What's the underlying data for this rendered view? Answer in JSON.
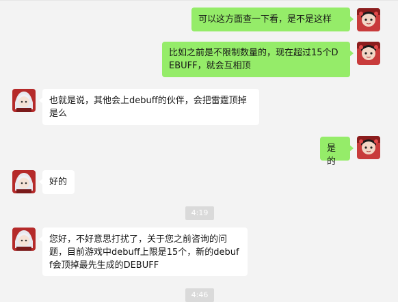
{
  "messages": [
    {
      "side": "out",
      "text": "可以这方面查一下看，是不是这样"
    },
    {
      "side": "out",
      "text": "比如之前是不限制数量的，现在超过15个DEBUFF，就会互相顶"
    },
    {
      "side": "in",
      "text": "也就是说，其他会上debuff的伙伴，会把雷霆顶掉是么"
    },
    {
      "side": "out",
      "text": "是的"
    },
    {
      "side": "in",
      "text": "好的"
    },
    {
      "side": "in",
      "text": "您好，不好意思打扰了，关于您之前咨询的问题，目前游戏中debuff上限是15个，新的debuff会顶掉最先生成的DEBUFF"
    }
  ],
  "timestamps": [
    "4:19",
    "4:46"
  ],
  "colors": {
    "background": "#f3f3f3",
    "outgoing_bubble": "#95ec69",
    "incoming_bubble": "#ffffff",
    "timestamp_bg": "#dadada"
  },
  "icons": {
    "user_avatar": "user-avatar-icon",
    "agent_avatar": "agent-avatar-icon"
  }
}
